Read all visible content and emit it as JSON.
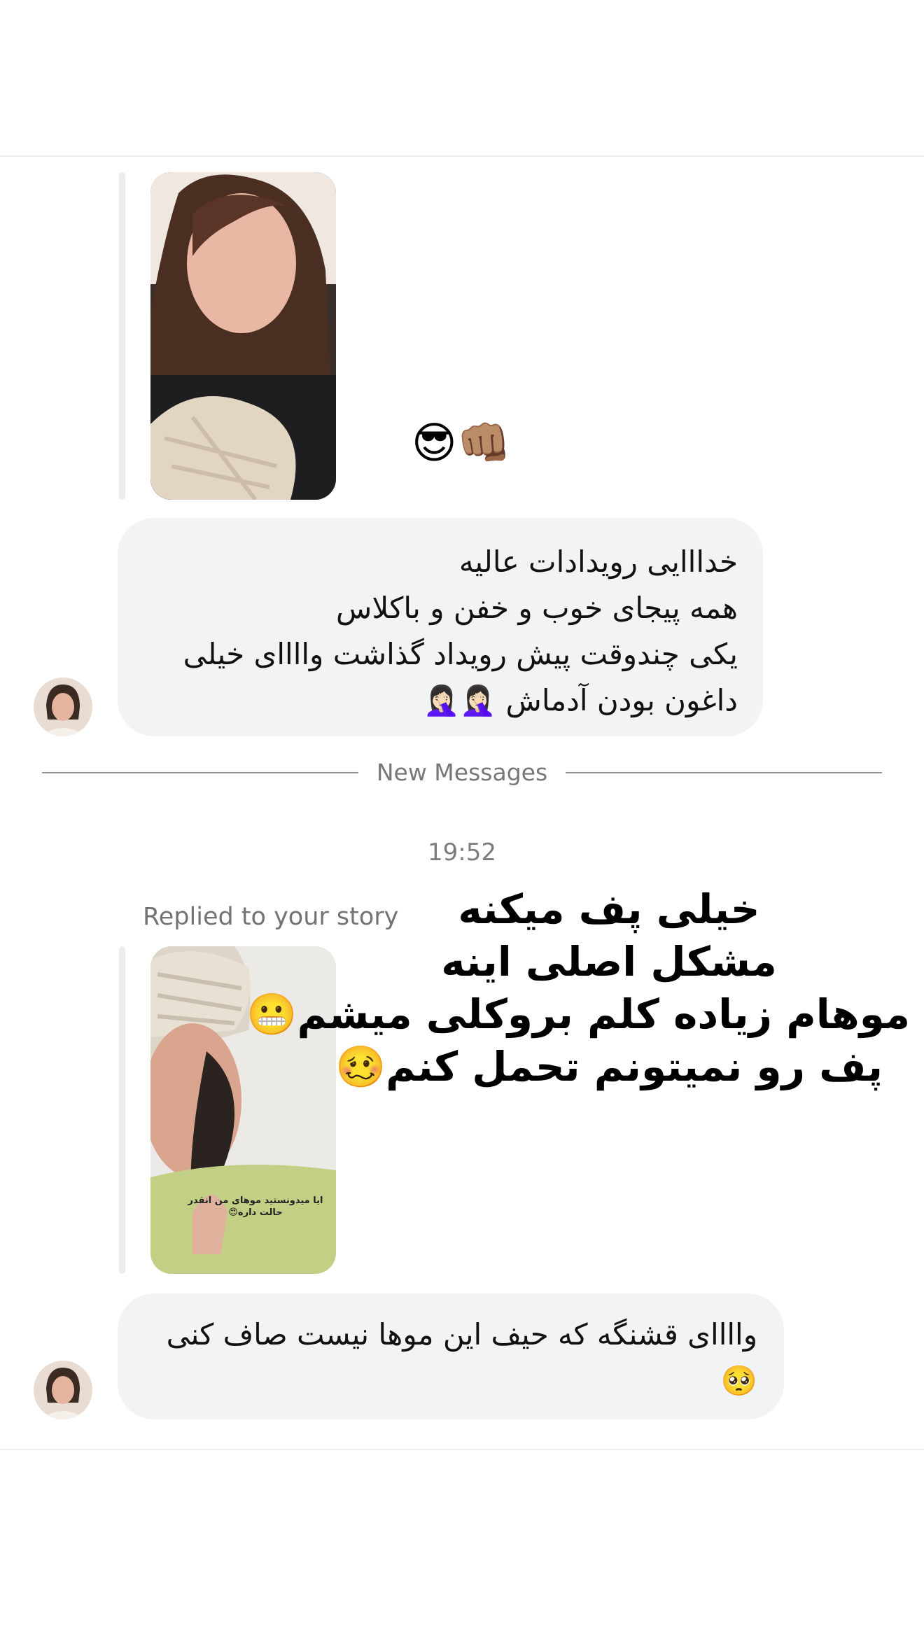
{
  "thread": {
    "divider_label": "New Messages",
    "timestamp": "19:52",
    "reply_label": "Replied to your story"
  },
  "messages": [
    {
      "sender": "contact",
      "reaction_emoji": "😎👊🏽",
      "bubble_lines": [
        "خدااایی رویدادات عالیه",
        "همه پیجای خوب و خفن و باکلاس",
        "یکی چندوقت پیش رویداد گذاشت واااای خیلی",
        "داغون بودن آدماش 🤦🏻‍♀️🤦🏻‍♀️"
      ]
    },
    {
      "sender": "contact",
      "story_caption": "ایا میدونستید موهای من انقدر حالت داره😍",
      "bubble_lines": [
        "واااای قشنگه که حیف این موها نیست صاف کنی",
        "🥺"
      ]
    }
  ],
  "overlay_text": {
    "lines": [
      "خیلی پف میکنه",
      "مشکل اصلی اینه",
      "موهام زیاده کلم بروکلی میشم😬",
      "پف رو نمیتونم تحمل کنم🥴"
    ]
  },
  "icons": {
    "avatar": "contact-avatar",
    "story_photo": "story-thumbnail"
  }
}
